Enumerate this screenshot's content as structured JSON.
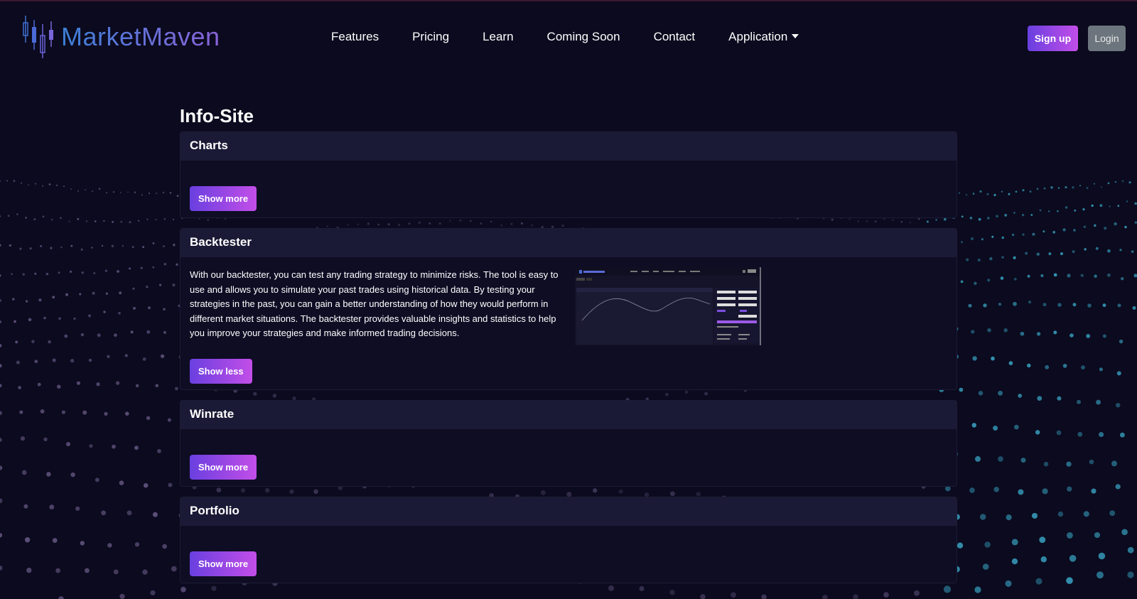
{
  "brand": {
    "name": "MarketMaven"
  },
  "nav": {
    "links": [
      "Features",
      "Pricing",
      "Learn",
      "Coming Soon",
      "Contact",
      "Application"
    ],
    "signup_label": "Sign up",
    "login_label": "Login"
  },
  "main": {
    "title": "Info-Site",
    "cards": [
      {
        "title": "Charts",
        "button": "Show more"
      },
      {
        "title": "Backtester",
        "description": "With our backtester, you can test any trading strategy to minimize risks. The tool is easy to use and allows you to simulate your past trades using historical data. By testing your strategies in the past, you can gain a better understanding of how they would perform in different market situations. The backtester provides valuable insights and statistics to help you improve your strategies and make informed trading decisions.",
        "button": "Show less"
      },
      {
        "title": "Winrate",
        "button": "Show more"
      },
      {
        "title": "Portfolio",
        "button": "Show more"
      }
    ]
  },
  "colors": {
    "background": "#0b0a1e",
    "card_header": "#1b1a36",
    "accent_start": "#6a3fe0",
    "accent_end": "#c34ee8",
    "login_button": "#6c757d"
  },
  "icons": {
    "logo": "candlestick-chart-icon",
    "dropdown": "caret-down-icon"
  }
}
